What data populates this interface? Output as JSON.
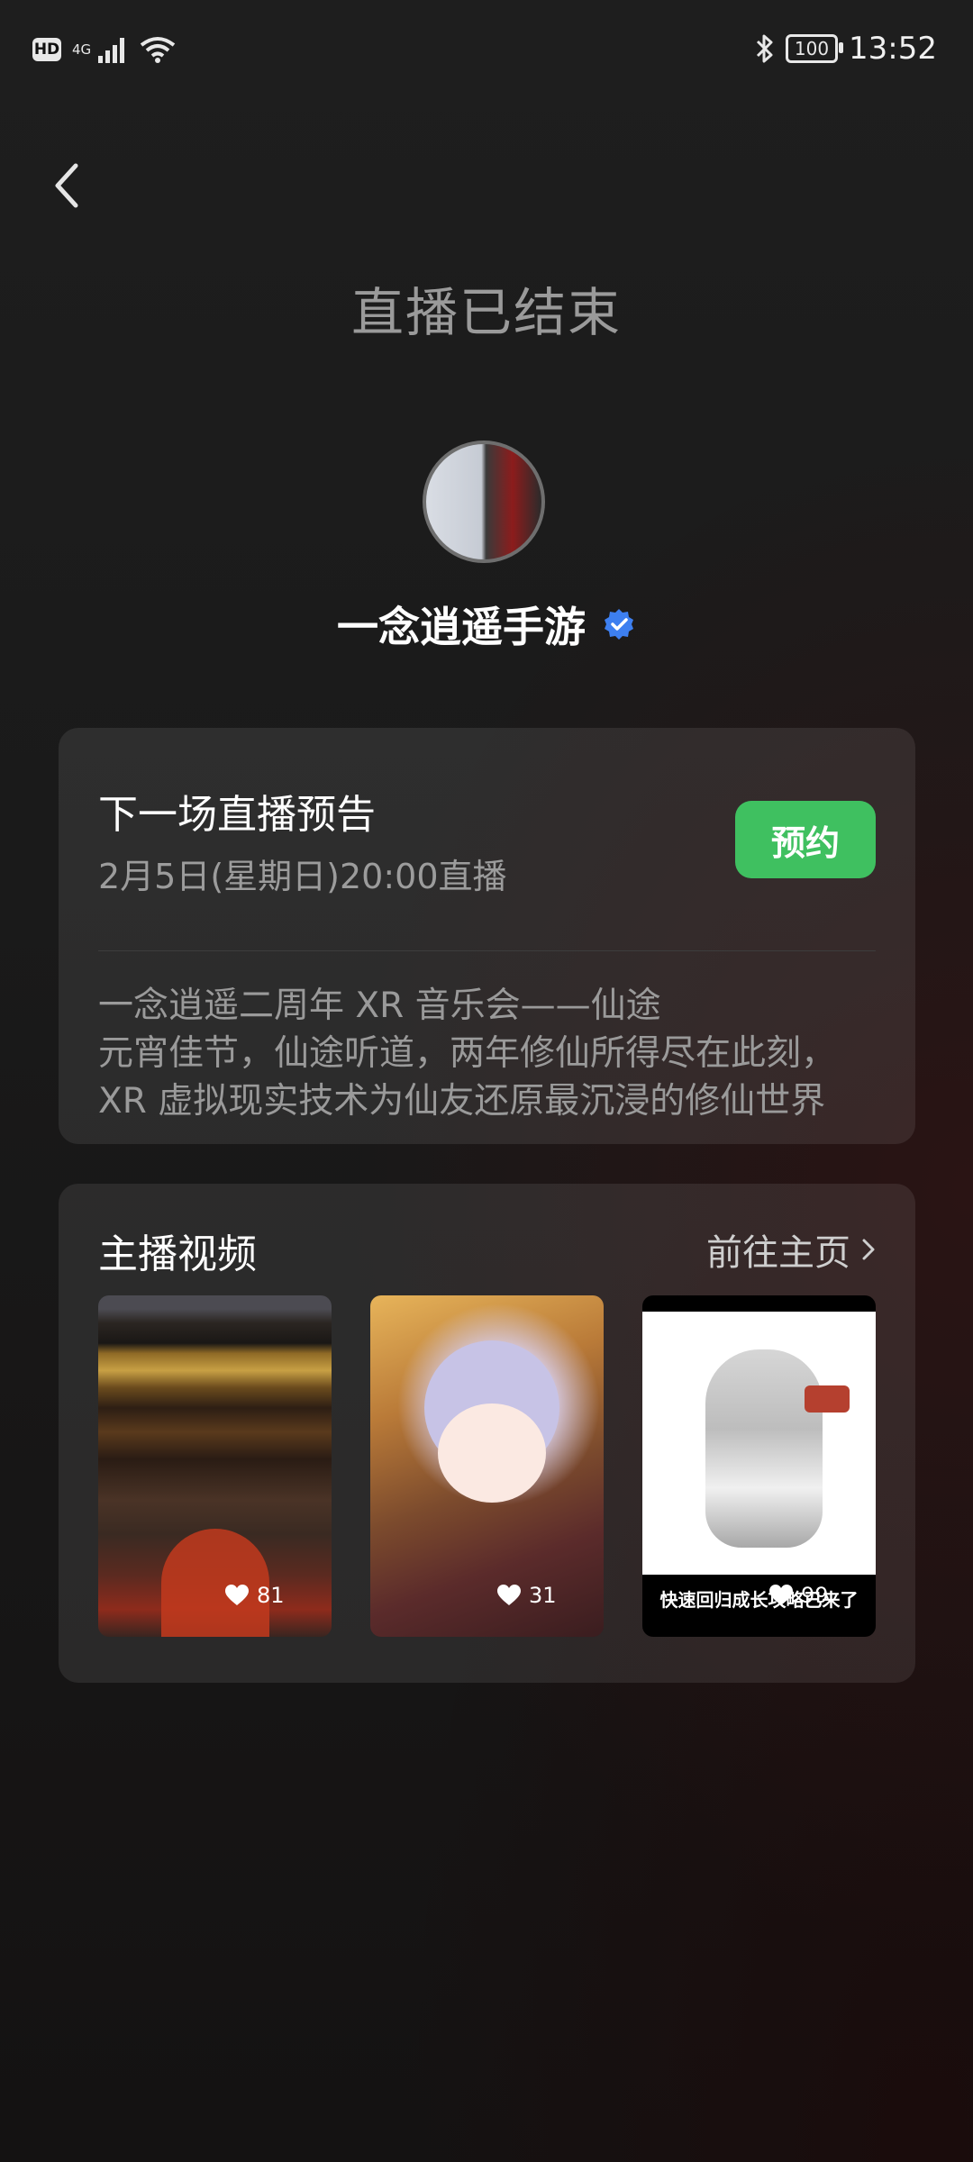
{
  "status_bar": {
    "hd": "HD",
    "network": "4G",
    "battery": "100",
    "time": "13:52"
  },
  "header": {
    "title": "直播已结束"
  },
  "anchor": {
    "name": "一念逍遥手游",
    "verified": true
  },
  "preview": {
    "title": "下一场直播预告",
    "time": "2月5日(星期日)20:00直播",
    "reserve_label": "预约",
    "desc_lines": [
      "一念逍遥二周年 XR 音乐会——仙途",
      "元宵佳节，仙途听道，两年修仙所得尽在此刻，",
      "XR 虚拟现实技术为仙友还原最沉浸的修仙世界"
    ]
  },
  "videos": {
    "title": "主播视频",
    "link_label": "前往主页",
    "items": [
      {
        "likes": "81",
        "caption": ""
      },
      {
        "likes": "31",
        "caption": ""
      },
      {
        "likes": "99",
        "caption": "快速回归成长攻略已来了"
      }
    ]
  },
  "colors": {
    "accent_green": "#3fc060",
    "verified_blue": "#3d7ff0"
  }
}
